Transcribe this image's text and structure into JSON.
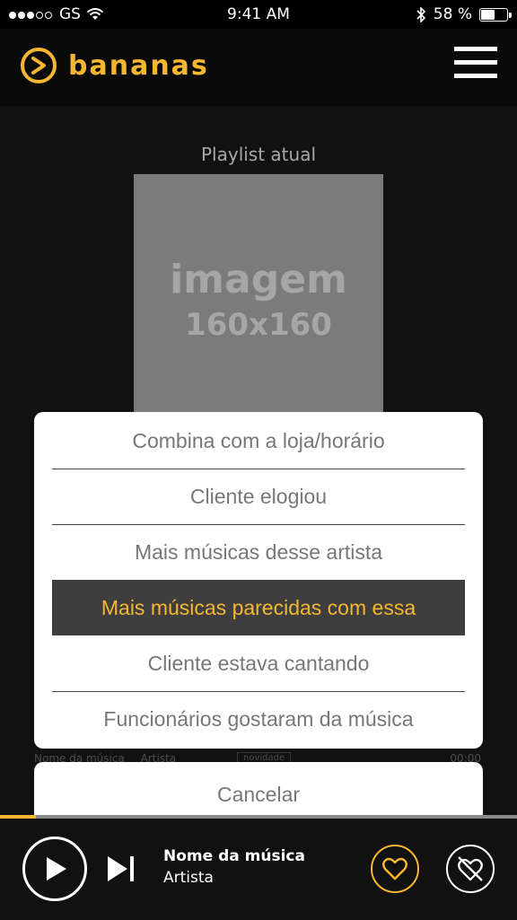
{
  "status_bar": {
    "carrier": "GS",
    "time": "9:41 AM",
    "battery": "58 %",
    "battery_level": 0.58
  },
  "header": {
    "brand": "bananas"
  },
  "main": {
    "playlist_label": "Playlist atual",
    "cover_text_1": "imagem",
    "cover_text_2": "160x160",
    "bg_row": {
      "song": "Nome da música",
      "artist": "Artista",
      "tag": "novidade",
      "duration": "00:00"
    }
  },
  "action_sheet": {
    "options": [
      {
        "label": "Combina com a loja/horário"
      },
      {
        "label": "Cliente elogiou"
      },
      {
        "label": "Mais músicas desse artista"
      },
      {
        "label": "Mais músicas parecidas com essa"
      },
      {
        "label": "Cliente estava cantando"
      },
      {
        "label": "Funcionários gostaram da música"
      }
    ],
    "selected_index": 3,
    "cancel_label": "Cancelar"
  },
  "player": {
    "song_name": "Nome da música",
    "artist": "Artista",
    "progress": 0.07
  },
  "colors": {
    "accent": "#f5b632",
    "background": "#1b1b1b",
    "header_bg": "#0a0a0a"
  }
}
